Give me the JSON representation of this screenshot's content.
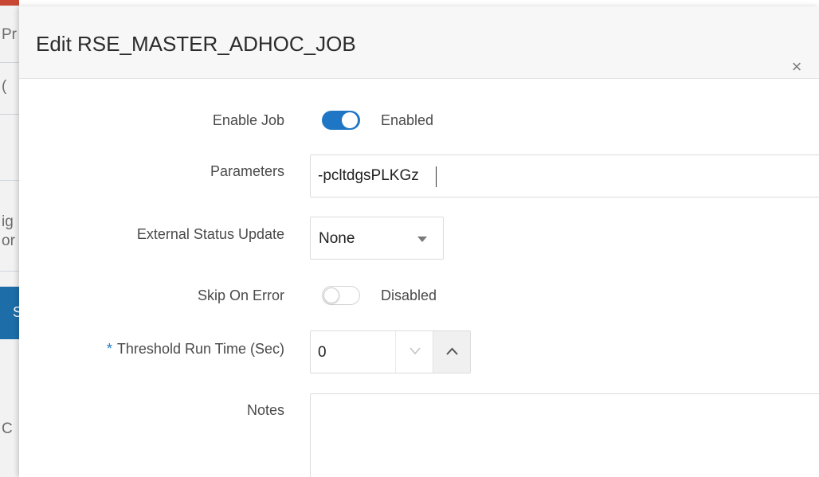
{
  "background": {
    "fragments": [
      "Pr",
      "(",
      "ig",
      "or",
      "S",
      "C"
    ],
    "accent_color": "#1d6ea8"
  },
  "dialog": {
    "title": "Edit RSE_MASTER_ADHOC_JOB",
    "close_icon": "close-icon",
    "close_glyph": "×"
  },
  "form": {
    "enable_job": {
      "label": "Enable Job",
      "on": true,
      "state": "Enabled"
    },
    "parameters": {
      "label": "Parameters",
      "value": "-pcltdgsPLKGz"
    },
    "external_status_update": {
      "label": "External Status Update",
      "value": "None",
      "icon": "chevron-down-icon"
    },
    "skip_on_error": {
      "label": "Skip On Error",
      "on": false,
      "state": "Disabled"
    },
    "threshold_run_time": {
      "required_mark": "*",
      "label": "Threshold Run Time (Sec)",
      "value": "0",
      "decrement_icon": "chevron-down-icon",
      "increment_icon": "chevron-up-icon"
    },
    "notes": {
      "label": "Notes",
      "value": ""
    }
  },
  "colors": {
    "toggle_on": "#1f76c5",
    "required_mark": "#1e7bc7",
    "header_bg": "#f7f7f7"
  }
}
